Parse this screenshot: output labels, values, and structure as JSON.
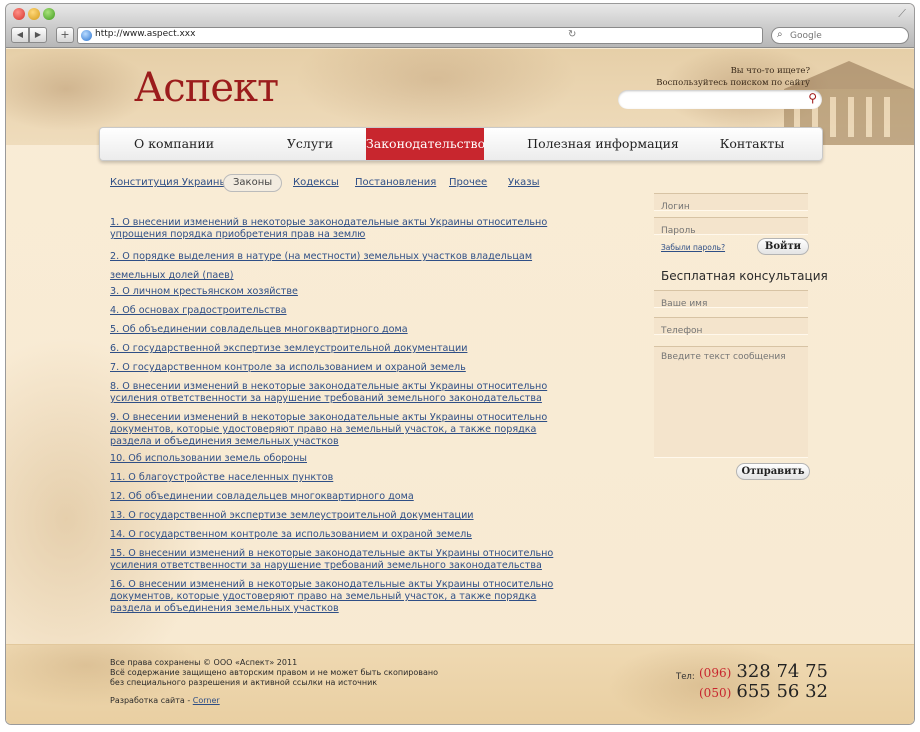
{
  "browser": {
    "url": "http://www.aspect.xxx",
    "search_placeholder": "Google"
  },
  "header": {
    "logo": "Аспект",
    "search_hint_line1": "Вы что-то ищете?",
    "search_hint_line2": "Воспользуйтесь поиском по сайту"
  },
  "menu": {
    "items": [
      "О компании",
      "Услуги",
      "Законодательство",
      "Полезная информация",
      "Контакты"
    ],
    "active": "Законодательство"
  },
  "subtabs": [
    "Конституция Украины",
    "Законы",
    "Кодексы",
    "Постановления",
    "Прочее",
    "Указы"
  ],
  "laws": [
    "1. О внесении изменений в некоторые законодательные акты Украины относительно упрощения порядка приобретения прав на землю",
    "2. О порядке выделения в натуре (на местности) земельных участков владельцам земельных долей (паев)",
    "3. О личном крестьянском хозяйстве",
    "4. Об основах градостроительства",
    "5. Об объединении совладельцев многоквартирного дома",
    "6. О государственной экспертизе землеустроительной документации",
    "7. О государственном контроле за использованием и охраной земель",
    "8. О внесении изменений в некоторые законодательные акты Украины относительно усиления ответственности за нарушение требований земельного законодательства",
    "9. О внесении изменений в некоторые законодательные акты Украины относительно документов, которые удостоверяют право на земельный участок, а также порядка раздела и объединения земельных участков",
    "10. Об использовании земель обороны",
    "11. О благоустройстве населенных пунктов",
    "12. Об объединении совладельцев многоквартирного дома",
    "13. О государственной экспертизе землеустроительной документации",
    "14. О государственном контроле за использованием и охраной земель",
    "15. О внесении изменений в некоторые законодательные акты Украины относительно усиления ответственности за нарушение требований земельного законодательства",
    "16. О внесении изменений в некоторые законодательные акты Украины относительно документов, которые удостоверяют право на земельный участок, а также порядка раздела и объединения земельных участков"
  ],
  "login": {
    "login_placeholder": "Логин",
    "password_placeholder": "Пароль",
    "forgot": "Забыли пароль?",
    "submit": "Войти"
  },
  "consult": {
    "title": "Бесплатная консультация",
    "name_placeholder": "Ваше имя",
    "phone_placeholder": "Телефон",
    "message_placeholder": "Введите текст сообщения",
    "submit": "Отправить"
  },
  "footer": {
    "copyright": "Все права сохранены © ООО «Аспект» 2011",
    "notice_line1": "Всё содержание защищено авторским правом и не может быть скопировано",
    "notice_line2": "без специального разрешения и активной ссылки на источник",
    "dev_label": "Разработка сайта - ",
    "dev_link": "Corner",
    "tel_label": "Тел:",
    "phones": [
      {
        "code": "(096)",
        "number": "328 74 75"
      },
      {
        "code": "(050)",
        "number": "655 56 32"
      }
    ]
  }
}
